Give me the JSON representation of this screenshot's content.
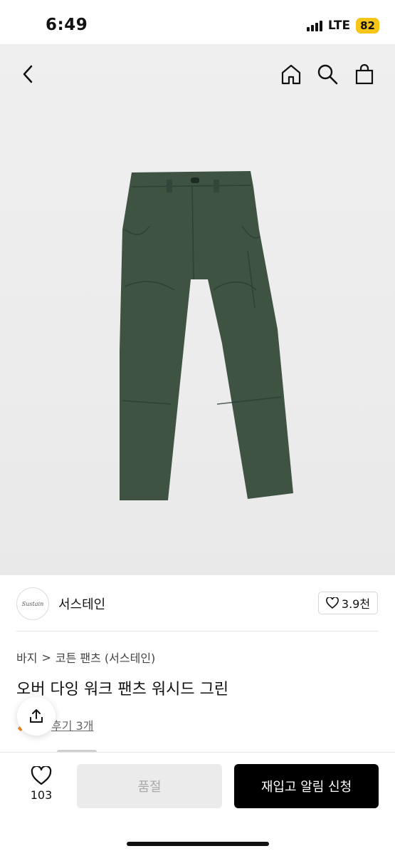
{
  "status": {
    "time": "6:49",
    "network": "LTE",
    "battery": "82"
  },
  "nav": {
    "back_icon": "chevron-left-icon",
    "home_icon": "home-icon",
    "search_icon": "search-icon",
    "bag_icon": "shopping-bag-icon"
  },
  "product_image": {
    "description_icon": "pants-image",
    "color": "#3d5240"
  },
  "brand": {
    "logo_text": "Sustain",
    "name": "서스테인",
    "likes": "3.9천"
  },
  "breadcrumb": {
    "category": "바지",
    "separator": ">",
    "subcategory": "코튼 팬츠 (서스테인)"
  },
  "product": {
    "title": "오버 다잉 워크 팬츠 워시드 그린",
    "review_text": "후기 3개"
  },
  "bottom": {
    "like_count": "103",
    "soldout_label": "품절",
    "restock_label": "재입고 알림 신청"
  }
}
